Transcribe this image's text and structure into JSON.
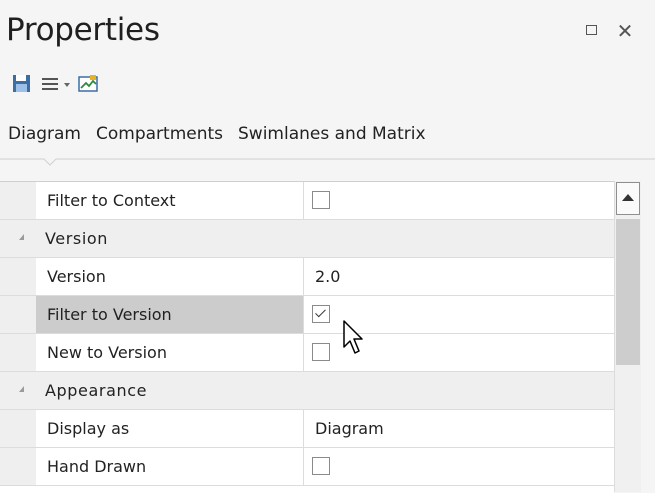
{
  "window": {
    "title": "Properties",
    "max_glyph": "☐",
    "close_glyph": "✕"
  },
  "toolbar": {
    "items": [
      {
        "icon": "save-icon"
      },
      {
        "icon": "menu-icon"
      },
      {
        "icon": "dropdown-arrow-icon"
      },
      {
        "icon": "diagram-image-icon"
      }
    ]
  },
  "tabs": [
    {
      "label": "Diagram"
    },
    {
      "label": "Compartments"
    },
    {
      "label": "Swimlanes and Matrix"
    }
  ],
  "rows": [
    {
      "type": "prop",
      "key": "Filter to Context",
      "checkbox": true,
      "checked": false
    },
    {
      "type": "group",
      "key": "Version"
    },
    {
      "type": "prop",
      "key": "Version",
      "value": "2.0"
    },
    {
      "type": "prop",
      "key": "Filter to Version",
      "checkbox": true,
      "checked": true,
      "selected": true
    },
    {
      "type": "prop",
      "key": "New to Version",
      "checkbox": true,
      "checked": false
    },
    {
      "type": "group",
      "key": "Appearance"
    },
    {
      "type": "prop",
      "key": "Display as",
      "value": "Diagram"
    },
    {
      "type": "prop",
      "key": "Hand Drawn",
      "checkbox": true,
      "checked": false
    }
  ],
  "colors": {
    "panel_bg": "#f5f5f5",
    "selected_row": "#cccccc",
    "group_bg": "#efefef"
  }
}
